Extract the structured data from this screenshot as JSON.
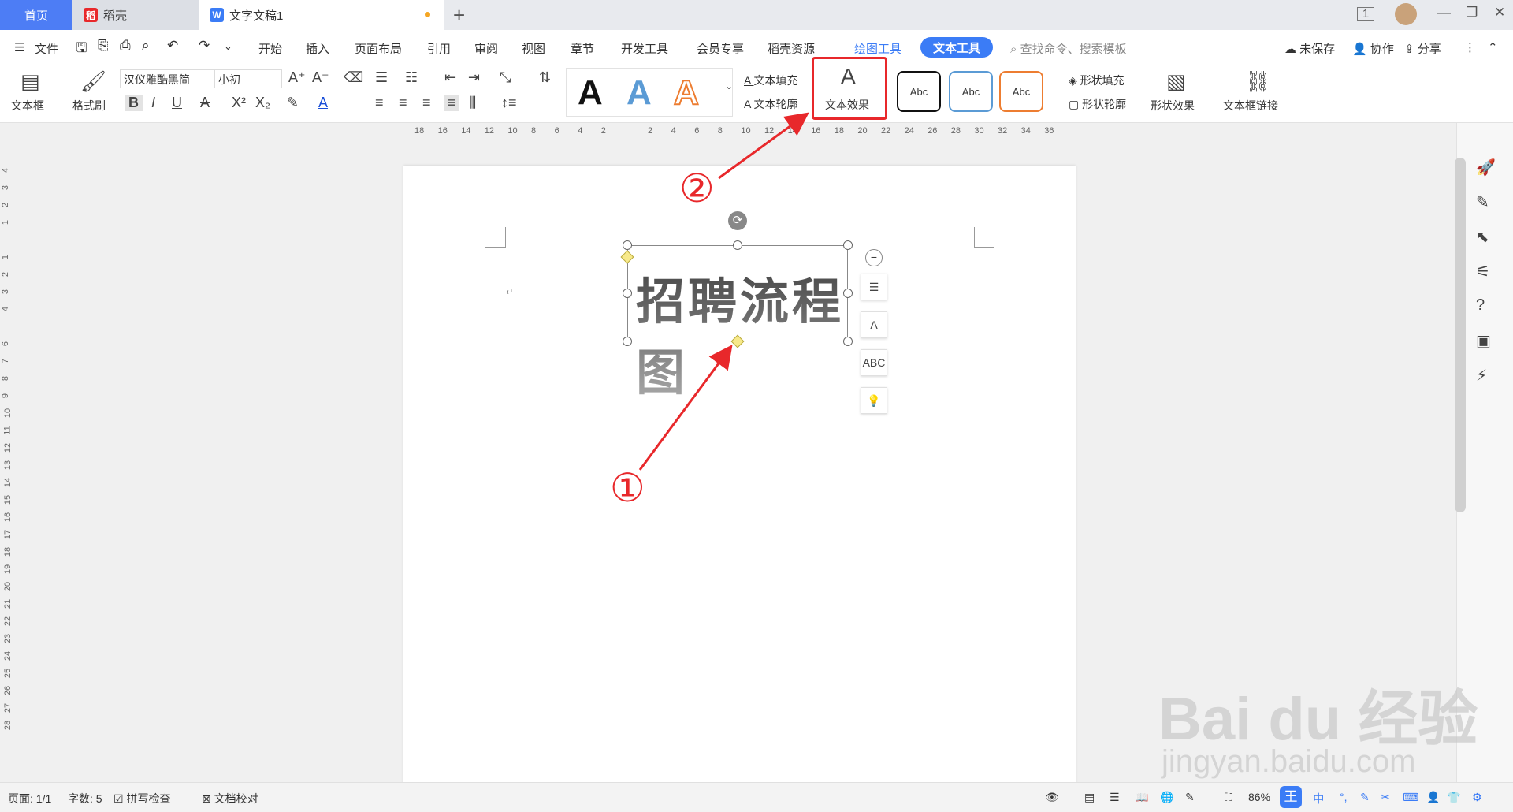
{
  "tabs": {
    "home": "首页",
    "daoke": "稻壳",
    "doc": "文字文稿1",
    "doc_icon": "W"
  },
  "menu": {
    "file": "文件",
    "items": [
      "开始",
      "插入",
      "页面布局",
      "引用",
      "审阅",
      "视图",
      "章节",
      "开发工具",
      "会员专享",
      "稻壳资源"
    ],
    "drawing_tools": "绘图工具",
    "text_tools": "文本工具",
    "search_placeholder": "查找命令、搜索模板",
    "unsaved": "未保存",
    "collab": "协作",
    "share": "分享"
  },
  "toolbar": {
    "textbox": "文本框",
    "format_painter": "格式刷",
    "font_name": "汉仪雅酷黑简",
    "font_size": "小初",
    "bold": "B",
    "italic": "I",
    "underline": "U",
    "superscript": "X²",
    "subscript": "X₂",
    "style_A": "A",
    "text_fill": "文本填充",
    "text_outline": "文本轮廓",
    "text_effect": "文本效果",
    "shape_style_label": "Abc",
    "shape_fill": "形状填充",
    "shape_outline": "形状轮廓",
    "shape_effect": "形状效果",
    "textbox_link": "文本框链接"
  },
  "ruler": {
    "h_ticks": [
      "18",
      "16",
      "14",
      "12",
      "10",
      "8",
      "6",
      "4",
      "2",
      "",
      "2",
      "4",
      "6",
      "8",
      "10",
      "12",
      "14",
      "16",
      "18",
      "20",
      "22",
      "24",
      "26",
      "28",
      "30",
      "32",
      "34",
      "36"
    ],
    "v_ticks": [
      "4",
      "3",
      "2",
      "1",
      "",
      "1",
      "2",
      "3",
      "4",
      "",
      "6",
      "7",
      "8",
      "9",
      "10",
      "11",
      "12",
      "13",
      "14",
      "15",
      "16",
      "17",
      "18",
      "19",
      "20",
      "21",
      "22",
      "23",
      "24",
      "25",
      "26",
      "27",
      "28"
    ]
  },
  "document": {
    "wordart_text": "招聘流程图",
    "para_mark": "↵"
  },
  "annotations": {
    "step1": "①",
    "step2": "②",
    "accent_color": "#e8282b"
  },
  "status": {
    "page": "页面: 1/1",
    "word_count": "字数: 5",
    "spell_check": "拼写检查",
    "doc_proof": "文档校对",
    "zoom": "86%",
    "ime": "中"
  },
  "watermark": {
    "logo": "Bai du 经验",
    "url": "jingyan.baidu.com"
  },
  "colors": {
    "accent_blue": "#3b7cf6",
    "tab_home": "#4d7df5"
  }
}
